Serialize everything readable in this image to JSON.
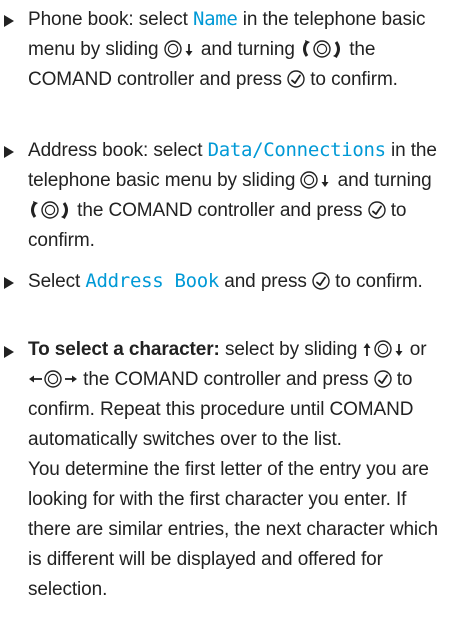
{
  "items": [
    {
      "pre": "Phone book: select ",
      "display": "Name",
      "mid1": " in the telephone basic menu by sliding ",
      "mid2": " and turning ",
      "mid3": " the COMAND controller and press ",
      "post": " to confirm."
    },
    {
      "pre": "Address book: select ",
      "display": "Data/Connections",
      "mid1": " in the telephone basic menu by sliding ",
      "mid2": " and turning ",
      "mid3": " the COMAND controller and press ",
      "post": " to confirm."
    },
    {
      "pre": "Select ",
      "display": "Address Book",
      "mid1": " and press ",
      "post": " to confirm."
    },
    {
      "bold": "To select a character:",
      "mid1": "  select by sliding ",
      "mid2": " or ",
      "mid3": " the COMAND controller and press ",
      "mid4": " to confirm. Repeat this procedure until COMAND automatically switches over to the list.",
      "para": "You determine the first letter of the entry you are looking for with the first character you enter. If there are similar entries, the next character which is different will be displayed and offered for selection."
    }
  ]
}
